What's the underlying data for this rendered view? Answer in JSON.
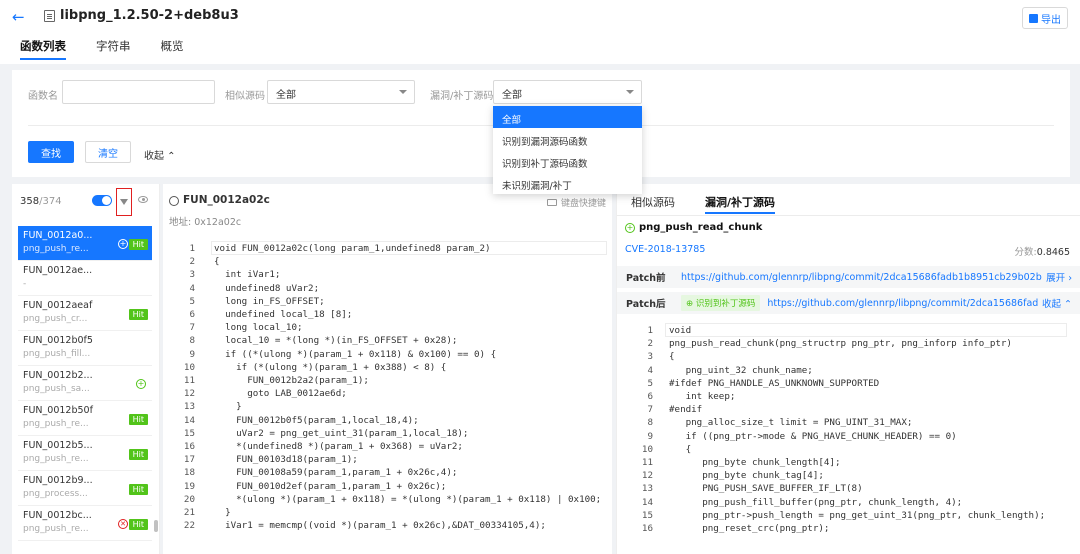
{
  "header": {
    "back_icon": "arrow-left-icon",
    "title": "libpng_1.2.50-2+deb8u3",
    "export_label": "导出",
    "tabs": [
      {
        "label": "函数列表",
        "active": true
      },
      {
        "label": "字符串",
        "active": false
      },
      {
        "label": "概览",
        "active": false
      }
    ]
  },
  "filter": {
    "name_label": "函数名",
    "name_value": "",
    "similar_label": "相似源码",
    "similar_value": "全部",
    "vuln_label": "漏洞/补丁源码",
    "vuln_value": "全部",
    "search_label": "查找",
    "clear_label": "清空",
    "collapse_label": "收起 ⌃",
    "dropdown_options": [
      "全部",
      "识别到漏洞源码函数",
      "识别到补丁源码函数",
      "未识别漏洞/补丁"
    ],
    "dropdown_selected": 0
  },
  "left": {
    "count_shown": "358",
    "count_total": "/374",
    "items": [
      {
        "name": "FUN_0012a0...",
        "sub": "png_push_re...",
        "hit": "Hit",
        "plus": true,
        "active": true
      },
      {
        "name": "FUN_0012ae...",
        "sub": "-",
        "hit": "",
        "plus": false,
        "active": false
      },
      {
        "name": "FUN_0012aeaf",
        "sub": "png_push_cr...",
        "hit": "Hit",
        "plus": false,
        "active": false
      },
      {
        "name": "FUN_0012b0f5",
        "sub": "png_push_fill...",
        "hit": "",
        "plus": false,
        "active": false
      },
      {
        "name": "FUN_0012b2...",
        "sub": "png_push_sa...",
        "hit": "",
        "plus": true,
        "active": false
      },
      {
        "name": "FUN_0012b50f",
        "sub": "png_push_re...",
        "hit": "Hit",
        "plus": false,
        "active": false
      },
      {
        "name": "FUN_0012b5...",
        "sub": "png_push_re...",
        "hit": "Hit",
        "plus": false,
        "active": false
      },
      {
        "name": "FUN_0012b9...",
        "sub": "png_process...",
        "hit": "Hit",
        "plus": false,
        "active": false
      },
      {
        "name": "FUN_0012bc...",
        "sub": "png_push_re...",
        "hit": "Hit",
        "xmark": true,
        "active": false
      }
    ]
  },
  "middle": {
    "title": "FUN_0012a02c",
    "address": "地址: 0x12a02c",
    "shortcut_label": "键盘快捷键",
    "line_numbers": "1\n2\n3\n4\n5\n6\n7\n8\n9\n10\n11\n12\n13\n14\n15\n16\n17\n18\n19\n20\n21\n22",
    "code": "void FUN_0012a02c(long param_1,undefined8 param_2)\n{\n  int iVar1;\n  undefined8 uVar2;\n  long in_FS_OFFSET;\n  undefined local_18 [8];\n  long local_10;\n  local_10 = *(long *)(in_FS_OFFSET + 0x28);\n  if ((*(ulong *)(param_1 + 0x118) & 0x100) == 0) {\n    if (*(ulong *)(param_1 + 0x388) < 8) {\n      FUN_0012b2a2(param_1);\n      goto LAB_0012ae6d;\n    }\n    FUN_0012b0f5(param_1,local_18,4);\n    uVar2 = png_get_uint_31(param_1,local_18);\n    *(undefined8 *)(param_1 + 0x368) = uVar2;\n    FUN_00103d18(param_1);\n    FUN_00108a59(param_1,param_1 + 0x26c,4);\n    FUN_0010d2ef(param_1,param_1 + 0x26c);\n    *(ulong *)(param_1 + 0x118) = *(ulong *)(param_1 + 0x118) | 0x100;\n  }\n  iVar1 = memcmp((void *)(param_1 + 0x26c),&DAT_00334105,4);"
  },
  "right": {
    "tabs": [
      {
        "label": "相似源码",
        "active": false
      },
      {
        "label": "漏洞/补丁源码",
        "active": true
      }
    ],
    "function_name": "png_push_read_chunk",
    "cve": "CVE-2018-13785",
    "score_label": "分数:",
    "score_value": "0.8465",
    "patch_before_label": "Patch前",
    "patch_before_url": "https://github.com/glennrp/libpng/commit/2dca15686fadb1b8951cb29b02bad4ca...",
    "patch_before_action": "展开 ›",
    "patch_after_label": "Patch后",
    "patch_after_badge": "识别到补丁源码",
    "patch_after_url": "https://github.com/glennrp/libpng/commit/2dca15686fadb1b...",
    "patch_after_action": "收起 ⌃",
    "line_numbers": "1\n2\n3\n4\n5\n6\n7\n8\n9\n10\n11\n12\n13\n14\n15\n16",
    "code": "void\npng_push_read_chunk(png_structrp png_ptr, png_inforp info_ptr)\n{\n   png_uint_32 chunk_name;\n#ifdef PNG_HANDLE_AS_UNKNOWN_SUPPORTED\n   int keep;\n#endif\n   png_alloc_size_t limit = PNG_UINT_31_MAX;\n   if ((png_ptr->mode & PNG_HAVE_CHUNK_HEADER) == 0)\n   {\n      png_byte chunk_length[4];\n      png_byte chunk_tag[4];\n      PNG_PUSH_SAVE_BUFFER_IF_LT(8)\n      png_push_fill_buffer(png_ptr, chunk_length, 4);\n      png_ptr->push_length = png_get_uint_31(png_ptr, chunk_length);\n      png_reset_crc(png_ptr);"
  }
}
